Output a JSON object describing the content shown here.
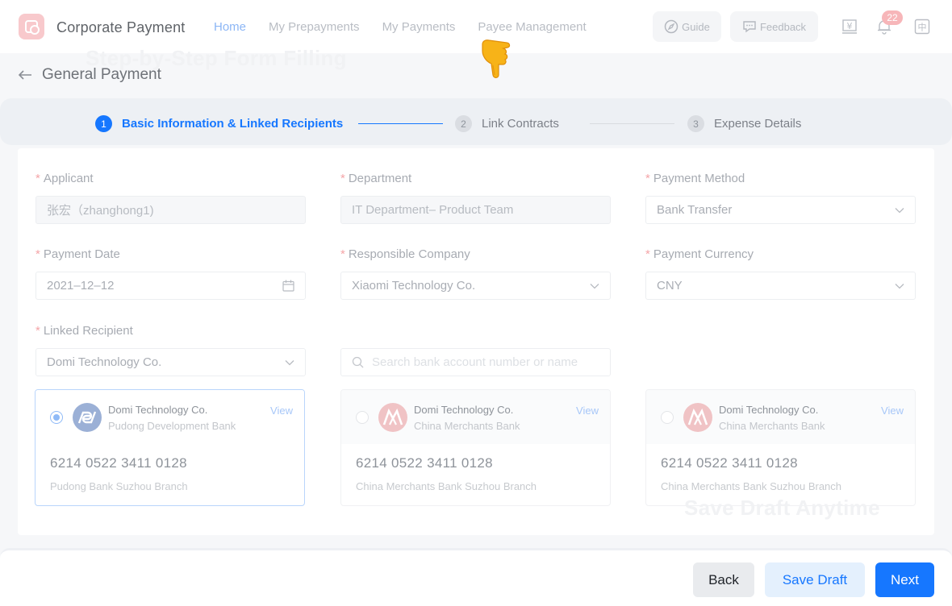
{
  "header": {
    "app_title": "Corporate Payment",
    "nav": [
      {
        "label": "Home",
        "active": true
      },
      {
        "label": "My Prepayments",
        "active": false
      },
      {
        "label": "My Payments",
        "active": false
      },
      {
        "label": "Payee Management",
        "active": false
      }
    ],
    "guide_label": "Guide",
    "feedback_label": "Feedback",
    "currency_icon_glyph": "¥",
    "notification_count": "22",
    "language_glyph": "中"
  },
  "overlays": {
    "top_caption": "Step-by-Step Form Filling",
    "bottom_caption": "Save Draft Anytime"
  },
  "page": {
    "title": "General Payment"
  },
  "steps": [
    {
      "number": "1",
      "label": "Basic Information & Linked Recipients",
      "state": "active"
    },
    {
      "number": "2",
      "label": "Link Contracts",
      "state": "pending"
    },
    {
      "number": "3",
      "label": "Expense Details",
      "state": "pending"
    }
  ],
  "form": {
    "applicant": {
      "label": "Applicant",
      "value": "张宏（zhanghong1)"
    },
    "department": {
      "label": "Department",
      "value": "IT Department– Product Team"
    },
    "payment_method": {
      "label": "Payment Method",
      "value": "Bank Transfer"
    },
    "payment_date": {
      "label": "Payment Date",
      "value": "2021–12–12"
    },
    "responsible_company": {
      "label": "Responsible Company",
      "value": "Xiaomi Technology Co."
    },
    "payment_currency": {
      "label": "Payment Currency",
      "value": "CNY"
    },
    "linked_recipient": {
      "label": "Linked Recipient",
      "value": "Domi Technology Co."
    },
    "search": {
      "placeholder": "Search bank account number or name"
    }
  },
  "recipients": [
    {
      "name": "Domi Technology Co.",
      "bank": "Pudong Development Bank",
      "view": "View",
      "account": "6214 0522 3411 0128",
      "branch": "Pudong Bank Suzhou Branch",
      "selected": true
    },
    {
      "name": "Domi Technology Co.",
      "bank": "China Merchants Bank",
      "view": "View",
      "account": "6214 0522 3411 0128",
      "branch": "China Merchants Bank Suzhou Branch",
      "selected": false
    },
    {
      "name": "Domi Technology Co.",
      "bank": "China Merchants Bank",
      "view": "View",
      "account": "6214 0522 3411 0128",
      "branch": "China Merchants Bank Suzhou Branch",
      "selected": false
    }
  ],
  "footer": {
    "back_label": "Back",
    "save_draft_label": "Save Draft",
    "next_label": "Next"
  },
  "colors": {
    "accent": "#1677ff",
    "required_mark": "#f5a5a8",
    "cmb_red": "#d4343a"
  }
}
